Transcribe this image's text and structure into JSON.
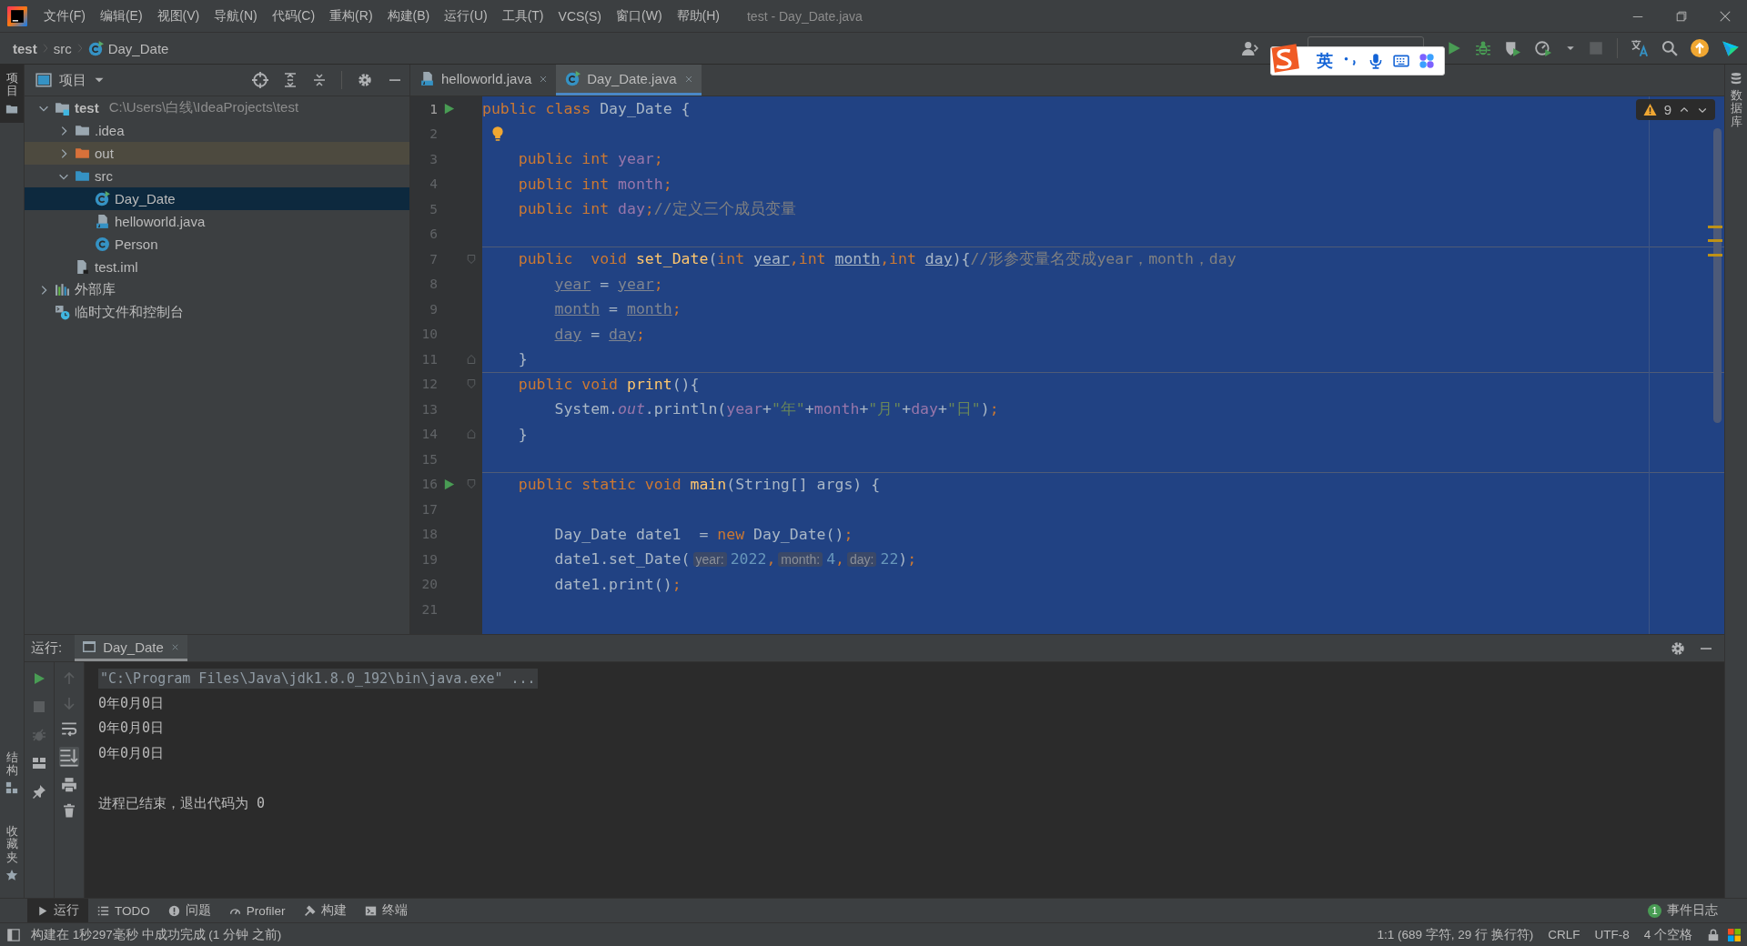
{
  "window": {
    "title": "test - Day_Date.java",
    "menu": [
      "文件(F)",
      "编辑(E)",
      "视图(V)",
      "导航(N)",
      "代码(C)",
      "重构(R)",
      "构建(B)",
      "运行(U)",
      "工具(T)",
      "VCS(S)",
      "窗口(W)",
      "帮助(H)"
    ]
  },
  "breadcrumb": [
    {
      "label": "test",
      "kind": "project"
    },
    {
      "label": "src",
      "kind": "folder"
    },
    {
      "label": "Day_Date",
      "kind": "class"
    }
  ],
  "ime_toolbar": {
    "mode": "英"
  },
  "left_stripe": {
    "top": [
      {
        "label": "项目",
        "selected": true
      }
    ],
    "bottom": [
      {
        "label": "结构",
        "selected": false
      },
      {
        "label": "收藏夹",
        "selected": false
      }
    ]
  },
  "right_stripe": [
    {
      "label": "数据库"
    }
  ],
  "project_panel": {
    "title": "项目",
    "tree": [
      {
        "label": "test",
        "path": "C:\\Users\\白线\\IdeaProjects\\test",
        "kind": "project",
        "expanded": true,
        "selected": false,
        "children": [
          {
            "label": ".idea",
            "kind": "folder",
            "expanded": false,
            "selected": false
          },
          {
            "label": "out",
            "kind": "excluded-folder",
            "expanded": false,
            "selected": false
          },
          {
            "label": "src",
            "kind": "source-folder",
            "expanded": true,
            "selected": false,
            "children": [
              {
                "label": "Day_Date",
                "kind": "class-run",
                "selected": true
              },
              {
                "label": "helloworld.java",
                "kind": "java-file",
                "selected": false
              },
              {
                "label": "Person",
                "kind": "class",
                "selected": false
              }
            ]
          },
          {
            "label": "test.iml",
            "kind": "iml",
            "selected": false
          }
        ]
      },
      {
        "label": "外部库",
        "kind": "library",
        "expanded": false,
        "selected": false
      },
      {
        "label": "临时文件和控制台",
        "kind": "scratch",
        "selected": false
      }
    ]
  },
  "editor": {
    "tabs": [
      {
        "label": "helloworld.java",
        "kind": "java-file",
        "selected": false
      },
      {
        "label": "Day_Date.java",
        "kind": "class-run",
        "selected": true
      }
    ],
    "warnings": "9",
    "lines": [
      {
        "number": "1",
        "current": true,
        "run": true,
        "separator": false,
        "tokens": [
          {
            "kind": "kw",
            "text": "public class "
          },
          {
            "kind": "plain",
            "text": "Day_Date {"
          }
        ]
      },
      {
        "number": "2",
        "current": false,
        "run": false,
        "separator": false,
        "hint_icon": {
          "kind": "bulb"
        }
      },
      {
        "number": "3",
        "current": false,
        "run": false,
        "separator": false,
        "tokens": [
          {
            "kind": "kw",
            "text": "    public int "
          },
          {
            "kind": "field",
            "text": "year"
          },
          {
            "kind": "punc",
            "text": ";"
          }
        ]
      },
      {
        "number": "4",
        "current": false,
        "run": false,
        "separator": false,
        "tokens": [
          {
            "kind": "kw",
            "text": "    public int "
          },
          {
            "kind": "field",
            "text": "month"
          },
          {
            "kind": "punc",
            "text": ";"
          }
        ]
      },
      {
        "number": "5",
        "current": false,
        "run": false,
        "separator": false,
        "tokens": [
          {
            "kind": "kw",
            "text": "    public int "
          },
          {
            "kind": "field",
            "text": "day"
          },
          {
            "kind": "punc",
            "text": ";"
          },
          {
            "kind": "cmt",
            "text": "//定义三个成员变量"
          }
        ]
      },
      {
        "number": "6",
        "current": false,
        "run": false,
        "separator": false
      },
      {
        "number": "7",
        "current": false,
        "run": false,
        "separator": true,
        "fold": {
          "kind": "open"
        },
        "tokens": [
          {
            "kind": "kw",
            "text": "    public  void "
          },
          {
            "kind": "fn",
            "text": "set_Date"
          },
          {
            "kind": "plain",
            "text": "("
          },
          {
            "kind": "kw",
            "text": "int "
          },
          {
            "kind": "param",
            "text": "year"
          },
          {
            "kind": "punc",
            "text": ","
          },
          {
            "kind": "kw",
            "text": "int "
          },
          {
            "kind": "param",
            "text": "month"
          },
          {
            "kind": "punc",
            "text": ","
          },
          {
            "kind": "kw",
            "text": "int "
          },
          {
            "kind": "param",
            "text": "day"
          },
          {
            "kind": "plain",
            "text": "){"
          },
          {
            "kind": "cmt",
            "text": "//形参变量名变成year，month，day"
          }
        ]
      },
      {
        "number": "8",
        "current": false,
        "run": false,
        "separator": false,
        "tokens": [
          {
            "kind": "unused",
            "text": "        year"
          },
          {
            "kind": "plain",
            "text": " = "
          },
          {
            "kind": "unused",
            "text": "year"
          },
          {
            "kind": "punc",
            "text": ";"
          }
        ]
      },
      {
        "number": "9",
        "current": false,
        "run": false,
        "separator": false,
        "tokens": [
          {
            "kind": "unused",
            "text": "        month"
          },
          {
            "kind": "plain",
            "text": " = "
          },
          {
            "kind": "unused",
            "text": "month"
          },
          {
            "kind": "punc",
            "text": ";"
          }
        ]
      },
      {
        "number": "10",
        "current": false,
        "run": false,
        "separator": false,
        "tokens": [
          {
            "kind": "unused",
            "text": "        day"
          },
          {
            "kind": "plain",
            "text": " = "
          },
          {
            "kind": "unused",
            "text": "day"
          },
          {
            "kind": "punc",
            "text": ";"
          }
        ]
      },
      {
        "number": "11",
        "current": false,
        "run": false,
        "separator": false,
        "fold": {
          "kind": "close"
        },
        "tokens": [
          {
            "kind": "plain",
            "text": "    }"
          }
        ]
      },
      {
        "number": "12",
        "current": false,
        "run": false,
        "separator": true,
        "fold": {
          "kind": "open"
        },
        "tokens": [
          {
            "kind": "kw",
            "text": "    public void "
          },
          {
            "kind": "fn",
            "text": "print"
          },
          {
            "kind": "plain",
            "text": "(){"
          }
        ]
      },
      {
        "number": "13",
        "current": false,
        "run": false,
        "separator": false,
        "tokens": [
          {
            "kind": "plain",
            "text": "        System."
          },
          {
            "kind": "static",
            "text": "out"
          },
          {
            "kind": "plain",
            "text": ".println("
          },
          {
            "kind": "field",
            "text": "year"
          },
          {
            "kind": "plain",
            "text": "+"
          },
          {
            "kind": "str",
            "text": "\"年\""
          },
          {
            "kind": "plain",
            "text": "+"
          },
          {
            "kind": "field",
            "text": "month"
          },
          {
            "kind": "plain",
            "text": "+"
          },
          {
            "kind": "str",
            "text": "\"月\""
          },
          {
            "kind": "plain",
            "text": "+"
          },
          {
            "kind": "field",
            "text": "day"
          },
          {
            "kind": "plain",
            "text": "+"
          },
          {
            "kind": "str",
            "text": "\"日\""
          },
          {
            "kind": "plain",
            "text": ")"
          },
          {
            "kind": "punc",
            "text": ";"
          }
        ]
      },
      {
        "number": "14",
        "current": false,
        "run": false,
        "separator": false,
        "fold": {
          "kind": "close"
        },
        "tokens": [
          {
            "kind": "plain",
            "text": "    }"
          }
        ]
      },
      {
        "number": "15",
        "current": false,
        "run": false,
        "separator": false
      },
      {
        "number": "16",
        "current": false,
        "run": true,
        "separator": true,
        "fold": {
          "kind": "open"
        },
        "tokens": [
          {
            "kind": "kw",
            "text": "    public static void "
          },
          {
            "kind": "fn",
            "text": "main"
          },
          {
            "kind": "plain",
            "text": "(String[] args) {"
          }
        ]
      },
      {
        "number": "17",
        "current": false,
        "run": false,
        "separator": false
      },
      {
        "number": "18",
        "current": false,
        "run": false,
        "separator": false,
        "tokens": [
          {
            "kind": "plain",
            "text": "        Day_Date date1  = "
          },
          {
            "kind": "kw",
            "text": "new "
          },
          {
            "kind": "plain",
            "text": "Day_Date()"
          },
          {
            "kind": "punc",
            "text": ";"
          }
        ]
      },
      {
        "number": "19",
        "current": false,
        "run": false,
        "separator": false,
        "tokens": [
          {
            "kind": "plain",
            "text": "        date1.set_Date("
          },
          {
            "kind": "hint",
            "text": "year:"
          },
          {
            "kind": "num",
            "text": "2022"
          },
          {
            "kind": "punc",
            "text": ","
          },
          {
            "kind": "hint",
            "text": "month:"
          },
          {
            "kind": "num",
            "text": "4"
          },
          {
            "kind": "punc",
            "text": ","
          },
          {
            "kind": "hint",
            "text": "day:"
          },
          {
            "kind": "num",
            "text": "22"
          },
          {
            "kind": "plain",
            "text": ")"
          },
          {
            "kind": "punc",
            "text": ";"
          }
        ]
      },
      {
        "number": "20",
        "current": false,
        "run": false,
        "separator": false,
        "tokens": [
          {
            "kind": "plain",
            "text": "        date1.print()"
          },
          {
            "kind": "punc",
            "text": ";"
          }
        ]
      },
      {
        "number": "21",
        "current": false,
        "run": false,
        "separator": false
      }
    ]
  },
  "run_panel": {
    "title": "运行:",
    "tabs": [
      {
        "label": "Day_Date",
        "selected": true
      }
    ],
    "console": [
      {
        "kind": "command",
        "text": "\"C:\\Program Files\\Java\\jdk1.8.0_192\\bin\\java.exe\" ..."
      },
      {
        "kind": "output",
        "text": "0年0月0日"
      },
      {
        "kind": "output",
        "text": "0年0月0日"
      },
      {
        "kind": "output",
        "text": "0年0月0日"
      },
      {
        "kind": "exit",
        "text": "进程已结束，退出代码为 0"
      }
    ]
  },
  "bottom_tools": [
    {
      "label": "运行",
      "kind": "run",
      "selected": true
    },
    {
      "label": "TODO",
      "kind": "todo",
      "selected": false
    },
    {
      "label": "问题",
      "kind": "problems",
      "selected": false
    },
    {
      "label": "Profiler",
      "kind": "profiler",
      "selected": false
    },
    {
      "label": "构建",
      "kind": "build",
      "selected": false
    },
    {
      "label": "终端",
      "kind": "terminal",
      "selected": false
    }
  ],
  "event_log": {
    "count": "1",
    "label": "事件日志"
  },
  "status_bar": {
    "message": "构建在 1秒297毫秒 中成功完成 (1 分钟 之前)",
    "items": [
      "1:1 (689 字符, 29 行 换行符)",
      "CRLF",
      "UTF-8",
      "4 个空格"
    ]
  }
}
